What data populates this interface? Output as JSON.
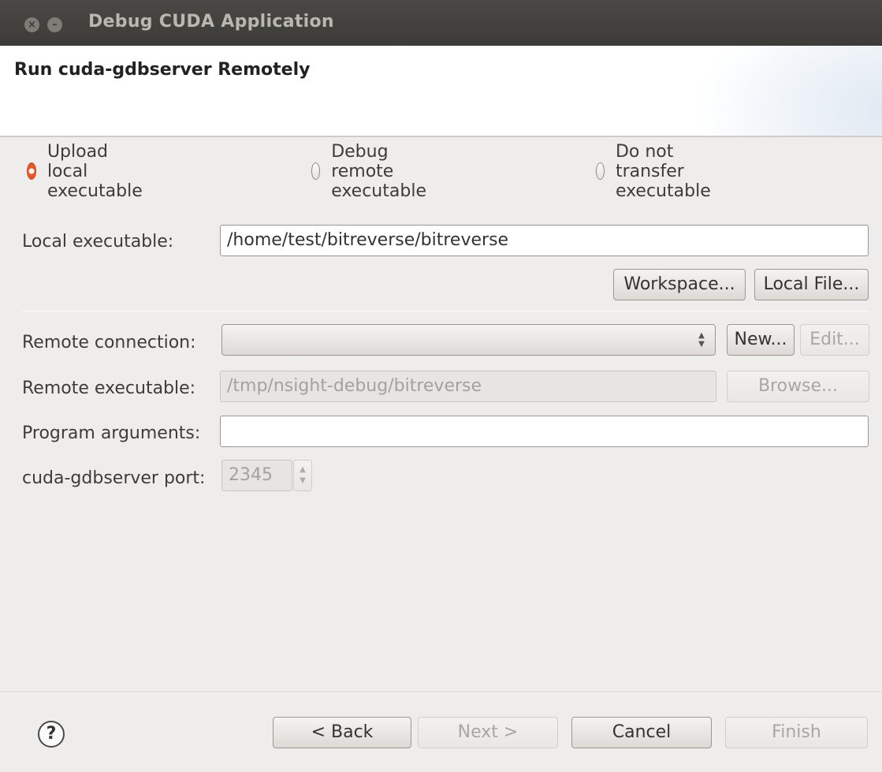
{
  "window": {
    "title": "Debug CUDA Application",
    "close_glyph": "×",
    "minimize_glyph": "–"
  },
  "header": {
    "title": "Run cuda-gdbserver Remotely"
  },
  "transfer_options": [
    {
      "label": "Upload local executable",
      "checked": true
    },
    {
      "label": "Debug remote executable",
      "checked": false
    },
    {
      "label": "Do not transfer executable",
      "checked": false
    }
  ],
  "form": {
    "local_executable": {
      "label": "Local executable:",
      "value": "/home/test/bitreverse/bitreverse",
      "workspace_button": "Workspace...",
      "local_file_button": "Local File..."
    },
    "remote_connection": {
      "label": "Remote connection:",
      "value": "",
      "new_button": "New...",
      "edit_button": "Edit..."
    },
    "remote_executable": {
      "label": "Remote executable:",
      "value": "/tmp/nsight-debug/bitreverse",
      "browse_button": "Browse..."
    },
    "program_arguments": {
      "label": "Program arguments:",
      "value": ""
    },
    "port": {
      "label": "cuda-gdbserver port:",
      "value": "2345"
    }
  },
  "footer": {
    "help_glyph": "?",
    "back": "< Back",
    "next": "Next >",
    "cancel": "Cancel",
    "finish": "Finish"
  },
  "colors": {
    "titlebar": "#3c3b37",
    "radio_accent": "#e2592b",
    "disabled_text": "#a5a29d"
  }
}
